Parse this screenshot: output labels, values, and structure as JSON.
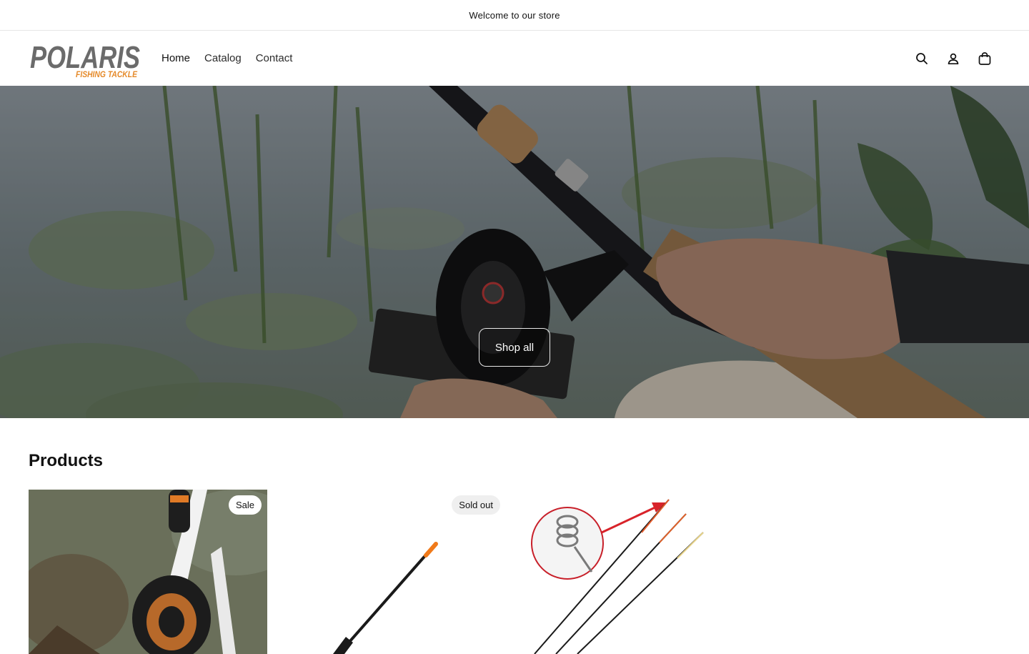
{
  "announcement": {
    "text": "Welcome to our store"
  },
  "brand": {
    "name_main": "POLARIS",
    "name_sub": "FISHING TACKLE",
    "colors": {
      "main": "#6b6b6b",
      "accent": "#e58a2a"
    }
  },
  "nav": {
    "items": [
      {
        "label": "Home"
      },
      {
        "label": "Catalog"
      },
      {
        "label": "Contact"
      }
    ]
  },
  "header_icons": {
    "search": "search-icon",
    "account": "account-icon",
    "cart": "cart-icon"
  },
  "hero": {
    "button_label": "Shop all"
  },
  "products": {
    "title": "Products",
    "items": [
      {
        "badge": "Sale"
      },
      {
        "badge": "Sold out"
      },
      {
        "badge": ""
      }
    ]
  }
}
